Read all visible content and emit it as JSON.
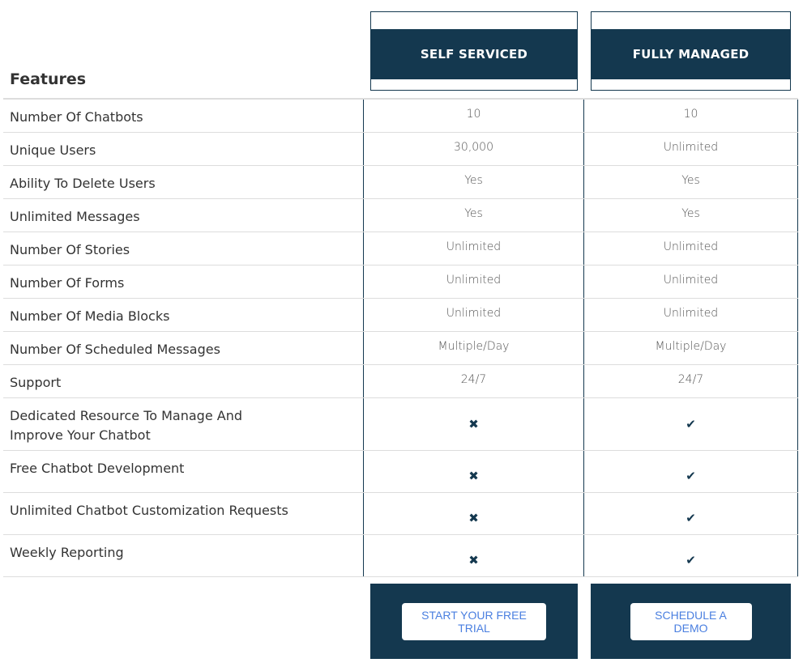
{
  "header": {
    "features_title": "Features",
    "plans": [
      {
        "name": "SELF SERVICED"
      },
      {
        "name": "FULLY MANAGED"
      }
    ]
  },
  "colors": {
    "brand_dark": "#14384f",
    "button_text": "#4a7fe0"
  },
  "rows": [
    {
      "label": "Number Of Chatbots",
      "self": "10",
      "managed": "10"
    },
    {
      "label": "Unique Users",
      "self": "30,000",
      "managed": "Unlimited"
    },
    {
      "label": "Ability To Delete Users",
      "self": "Yes",
      "managed": "Yes"
    },
    {
      "label": "Unlimited Messages",
      "self": "Yes",
      "managed": "Yes"
    },
    {
      "label": "Number Of Stories",
      "self": "Unlimited",
      "managed": "Unlimited"
    },
    {
      "label": "Number Of Forms",
      "self": "Unlimited",
      "managed": "Unlimited"
    },
    {
      "label": "Number Of Media Blocks",
      "self": "Unlimited",
      "managed": "Unlimited"
    },
    {
      "label": "Number Of Scheduled Messages",
      "self": "Multiple/Day",
      "managed": "Multiple/Day"
    },
    {
      "label": "Support",
      "self": "24/7",
      "managed": "24/7"
    }
  ],
  "icon_rows": [
    {
      "label": "Dedicated Resource To Manage And Improve Your Chatbot",
      "self": "cross-icon",
      "managed": "check-icon"
    },
    {
      "label": "Free Chatbot Development",
      "self": "cross-icon",
      "managed": "check-icon"
    },
    {
      "label": "Unlimited Chatbot Customization Requests",
      "self": "cross-icon",
      "managed": "check-icon"
    },
    {
      "label": "Weekly Reporting",
      "self": "cross-icon",
      "managed": "check-icon"
    }
  ],
  "icons": {
    "cross": "✖",
    "check": "✔"
  },
  "cta": {
    "self_label": "START YOUR FREE TRIAL",
    "managed_label": "SCHEDULE A DEMO"
  }
}
